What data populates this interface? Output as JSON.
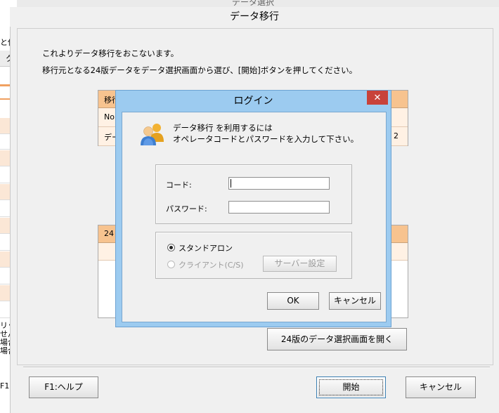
{
  "background_window": {
    "title_fragment": "データ選択",
    "left_fragments": [
      "と保",
      "ク",
      "No",
      "デ",
      "リック",
      "せん",
      "場合",
      "場合",
      "F1:"
    ]
  },
  "migration_window": {
    "title": "データ移行",
    "description_line1": "これよりデータ移行をおこないます。",
    "description_line2": "移行元となる24版データをデータ選択画面から選び、[開始]ボタンを押してください。",
    "table1_header_fragment": "移行",
    "table1_row1_fragment": "No",
    "table1_row2_fragment": "デー",
    "table1_row2_right_fragment": "2",
    "table2_header_fragment": "24",
    "open_button": "24版のデータ選択画面を開く",
    "help_button": "F1:ヘルプ",
    "start_button": "開始",
    "cancel_button": "キャンセル"
  },
  "login_dialog": {
    "title": "ログイン",
    "close_label": "✕",
    "message_line1": "データ移行 を利用するには",
    "message_line2": "オペレータコードとパスワードを入力して下さい。",
    "code_label": "コード:",
    "code_value": "",
    "password_label": "パスワード:",
    "password_value": "",
    "mode_standalone": "スタンドアロン",
    "mode_client": "クライアント(C/S)",
    "server_settings_button": "サーバー設定",
    "ok_button": "OK",
    "cancel_button": "キャンセル",
    "selected_mode": "standalone"
  },
  "colors": {
    "dialog_border": "#9ccbf0",
    "close_red": "#c8423a",
    "table_header_orange": "#f7c38f"
  }
}
